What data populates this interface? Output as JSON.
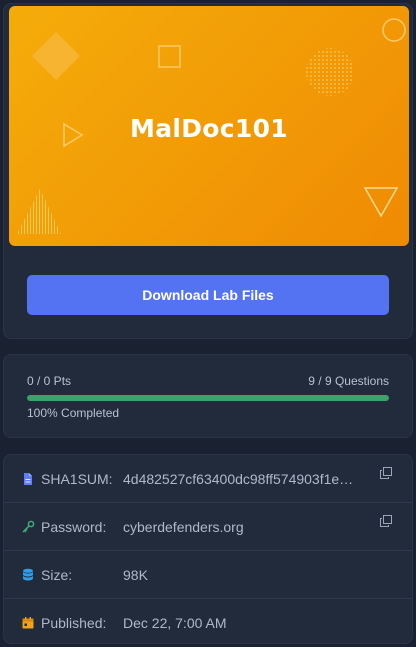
{
  "banner": {
    "title": "MalDoc101",
    "gradient": [
      "#f4ac0a",
      "#ef8a04"
    ]
  },
  "actions": {
    "download_label": "Download Lab Files",
    "download_color": "#5473f3"
  },
  "progress": {
    "points": "0 / 0 Pts",
    "questions": "9 / 9 Questions",
    "percent_text": "100% Completed",
    "fraction": 1.0,
    "fill_color": "#3aa26a"
  },
  "details": {
    "sha1": {
      "icon": "file-icon",
      "label": "SHA1SUM:",
      "value": "4d482527cf63400dc98ff574903f1e…"
    },
    "password": {
      "icon": "key-icon",
      "label": "Password:",
      "value": "cyberdefenders.org"
    },
    "size": {
      "icon": "database-icon",
      "label": "Size:",
      "value": "98K"
    },
    "published": {
      "icon": "calendar-icon",
      "label": "Published:",
      "value": "Dec 22, 7:00 AM"
    }
  }
}
